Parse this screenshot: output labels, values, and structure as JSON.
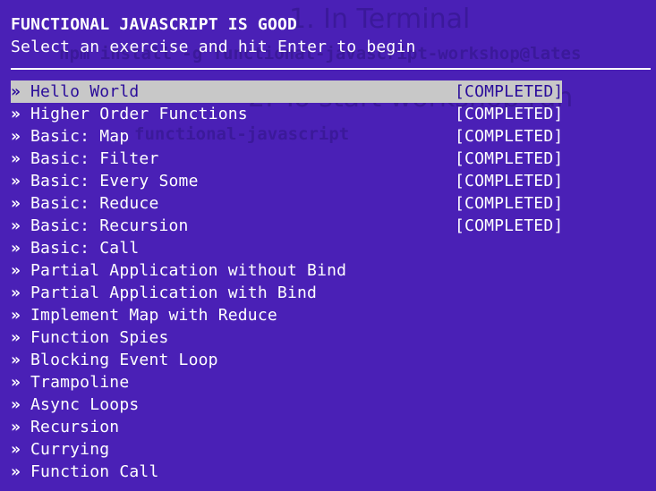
{
  "background": {
    "heading_1": "1. In Terminal",
    "code_1": "npm install -g functional-javascript-workshop@lates",
    "heading_2": "2. To start workshop run",
    "code_2": "functional-javascript"
  },
  "terminal": {
    "title": "FUNCTIONAL JAVASCRIPT IS GOOD",
    "subtitle": "Select an exercise and hit Enter to begin",
    "arrow": "»",
    "status_completed": "[COMPLETED]",
    "colors": {
      "background": "#4a20b6",
      "text": "#ffffff",
      "selection_bg": "#c8c8c8",
      "selection_text": "#2a0c9a"
    },
    "exercises": [
      {
        "label": "Hello World",
        "status": "[COMPLETED]",
        "selected": true
      },
      {
        "label": "Higher Order Functions",
        "status": "[COMPLETED]"
      },
      {
        "label": "Basic: Map",
        "status": "[COMPLETED]"
      },
      {
        "label": "Basic: Filter",
        "status": "[COMPLETED]"
      },
      {
        "label": "Basic: Every Some",
        "status": "[COMPLETED]"
      },
      {
        "label": "Basic: Reduce",
        "status": "[COMPLETED]"
      },
      {
        "label": "Basic: Recursion",
        "status": "[COMPLETED]"
      },
      {
        "label": "Basic: Call",
        "status": ""
      },
      {
        "label": "Partial Application without Bind",
        "status": ""
      },
      {
        "label": "Partial Application with Bind",
        "status": ""
      },
      {
        "label": "Implement Map with Reduce",
        "status": ""
      },
      {
        "label": "Function Spies",
        "status": ""
      },
      {
        "label": "Blocking Event Loop",
        "status": ""
      },
      {
        "label": "Trampoline",
        "status": ""
      },
      {
        "label": "Async Loops",
        "status": ""
      },
      {
        "label": "Recursion",
        "status": ""
      },
      {
        "label": "Currying",
        "status": ""
      },
      {
        "label": "Function Call",
        "status": ""
      }
    ]
  }
}
